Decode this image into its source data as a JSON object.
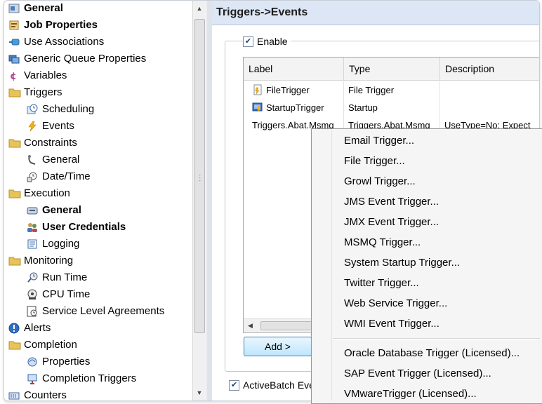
{
  "tree": {
    "items": [
      {
        "label": "General",
        "icon": "general-icon",
        "bold": true,
        "indent": 0
      },
      {
        "label": "Job Properties",
        "icon": "properties-icon",
        "bold": true,
        "indent": 0
      },
      {
        "label": "Use Associations",
        "icon": "associations-icon",
        "bold": false,
        "indent": 0
      },
      {
        "label": "Generic Queue Properties",
        "icon": "queue-icon",
        "bold": false,
        "indent": 0
      },
      {
        "label": "Variables",
        "icon": "variables-icon",
        "bold": false,
        "indent": 0
      },
      {
        "label": "Triggers",
        "icon": "folder-icon",
        "bold": false,
        "indent": 0
      },
      {
        "label": "Scheduling",
        "icon": "clock-icon",
        "bold": false,
        "indent": 1
      },
      {
        "label": "Events",
        "icon": "lightning-icon",
        "bold": false,
        "indent": 1
      },
      {
        "label": "Constraints",
        "icon": "folder-icon",
        "bold": false,
        "indent": 0
      },
      {
        "label": "General",
        "icon": "constraint-general-icon",
        "bold": false,
        "indent": 1
      },
      {
        "label": "Date/Time",
        "icon": "datetime-icon",
        "bold": false,
        "indent": 1
      },
      {
        "label": "Execution",
        "icon": "folder-icon",
        "bold": false,
        "indent": 0
      },
      {
        "label": "General",
        "icon": "execution-general-icon",
        "bold": true,
        "indent": 1
      },
      {
        "label": "User Credentials",
        "icon": "users-icon",
        "bold": true,
        "indent": 1
      },
      {
        "label": "Logging",
        "icon": "log-icon",
        "bold": false,
        "indent": 1
      },
      {
        "label": "Monitoring",
        "icon": "folder-icon",
        "bold": false,
        "indent": 0
      },
      {
        "label": "Run Time",
        "icon": "runtime-icon",
        "bold": false,
        "indent": 1
      },
      {
        "label": "CPU Time",
        "icon": "cpu-icon",
        "bold": false,
        "indent": 1
      },
      {
        "label": "Service Level Agreements",
        "icon": "sla-icon",
        "bold": false,
        "indent": 1
      },
      {
        "label": "Alerts",
        "icon": "alert-icon",
        "bold": false,
        "indent": 0
      },
      {
        "label": "Completion",
        "icon": "folder-icon",
        "bold": false,
        "indent": 0
      },
      {
        "label": "Properties",
        "icon": "completion-properties-icon",
        "bold": false,
        "indent": 1
      },
      {
        "label": "Completion Triggers",
        "icon": "completion-triggers-icon",
        "bold": false,
        "indent": 1
      },
      {
        "label": "Counters",
        "icon": "counters-icon",
        "bold": false,
        "indent": 0
      }
    ]
  },
  "panel": {
    "title": "Triggers->Events",
    "enable_label": "Enable",
    "enable_checked": true,
    "grid": {
      "columns": [
        "Label",
        "Type",
        "Description"
      ],
      "rows": [
        {
          "label": "FileTrigger",
          "type": "File Trigger",
          "description": "",
          "icon": "file-trigger-icon"
        },
        {
          "label": "StartupTrigger",
          "type": "Startup",
          "description": "",
          "icon": "startup-trigger-icon"
        },
        {
          "label": "Triggers.Abat.Msmq",
          "type": "Triggers.Abat.Msmq",
          "description": "UseType=No; Expect",
          "icon": ""
        }
      ]
    },
    "add_button": "Add  >",
    "activebatch_label": "ActiveBatch Eve",
    "activebatch_checked": true
  },
  "menu": {
    "items": [
      "Email Trigger...",
      "File Trigger...",
      "Growl Trigger...",
      "JMS Event Trigger...",
      "JMX Event Trigger...",
      "MSMQ Trigger...",
      "System Startup Trigger...",
      "Twitter Trigger...",
      "Web Service Trigger...",
      "WMI Event Trigger..."
    ],
    "licensed_items": [
      "Oracle Database Trigger (Licensed)...",
      "SAP Event Trigger (Licensed)...",
      "VMwareTrigger (Licensed)..."
    ]
  },
  "colors": {
    "panel_header_bg": "#dce6f4",
    "folder": "#e8c35a",
    "accent_blue": "#3c7fb1"
  }
}
